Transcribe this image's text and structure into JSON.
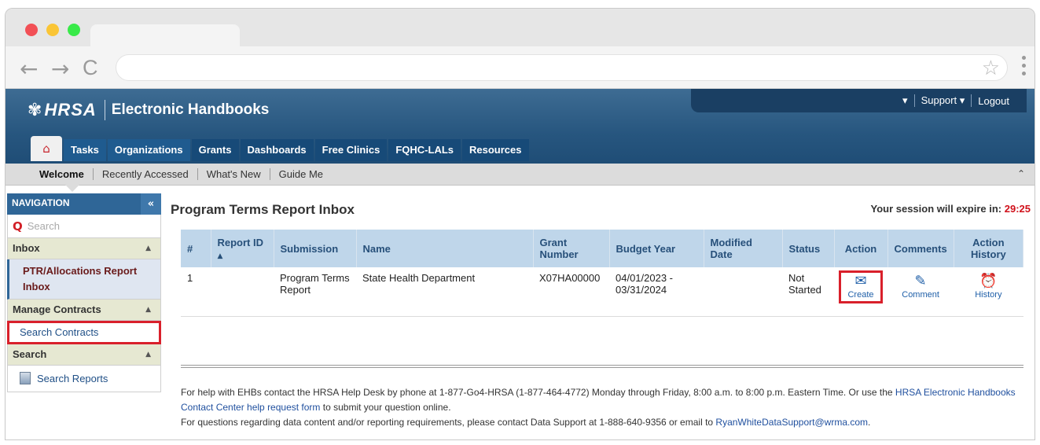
{
  "browser": {
    "back": "←",
    "forward": "→",
    "reload": "C",
    "bookmark": "☆"
  },
  "header": {
    "logo_text": "HRSA",
    "app_title": "Electronic Handbooks",
    "utility": [
      "Support ▾",
      "Logout"
    ],
    "utility_caret": "▾"
  },
  "main_nav": [
    "Tasks",
    "Organizations",
    "Grants",
    "Dashboards",
    "Free Clinics",
    "FQHC-LALs",
    "Resources"
  ],
  "sub_nav": [
    "Welcome",
    "Recently Accessed",
    "What's New",
    "Guide Me"
  ],
  "sidebar": {
    "title": "NAVIGATION",
    "search_placeholder": "Search",
    "sections": [
      {
        "label": "Inbox",
        "links": [
          "PTR/Allocations Report Inbox"
        ]
      },
      {
        "label": "Manage Contracts",
        "links": [
          "Search Contracts"
        ]
      },
      {
        "label": "Search",
        "links": [
          "Search Reports"
        ]
      }
    ]
  },
  "page": {
    "title": "Program Terms Report Inbox",
    "session_label": "Your session will expire in:",
    "session_time": "29:25"
  },
  "table": {
    "columns": [
      "#",
      "Report ID",
      "Submission",
      "Name",
      "Grant Number",
      "Budget Year",
      "Modified Date",
      "Status",
      "Action",
      "Comments",
      "Action History"
    ],
    "rows": [
      {
        "num": "1",
        "report_id": "",
        "submission": "Program Terms Report",
        "name": "State Health Department",
        "grant_number": "X07HA00000",
        "budget_year": "04/01/2023 - 03/31/2024",
        "modified_date": "",
        "status": "Not Started",
        "action": "Create",
        "comments": "Comment",
        "history": "History"
      }
    ]
  },
  "help": {
    "line1": "For help with EHBs contact the HRSA Help Desk by phone at 1-877-Go4-HRSA (1-877-464-4772) Monday through Friday, 8:00 a.m. to 8:00 p.m. Eastern Time. Or use the",
    "line1_link": "HRSA Electronic Handbooks Contact Center help request form",
    "line1_end": "to submit your question online.",
    "line2": "For questions regarding data content and/or reporting requirements, please contact Data Support at 1-888-640-9356 or email to",
    "line2_link": "RyanWhiteDataSupport@wrma.com",
    "line2_end": "."
  }
}
